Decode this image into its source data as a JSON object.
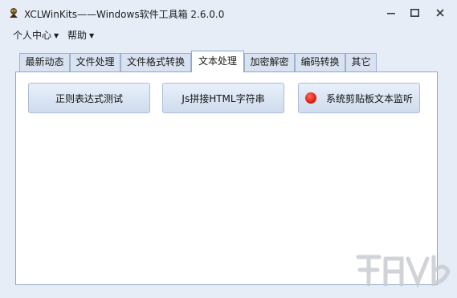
{
  "window": {
    "title": "XCLWinKits——Windows软件工具箱 2.6.0.0",
    "controls": {
      "minimize": "minimize-icon",
      "maximize": "maximize-icon",
      "close": "close-icon"
    }
  },
  "menu": {
    "items": [
      {
        "label": "个人中心"
      },
      {
        "label": "帮助"
      }
    ]
  },
  "tabs": [
    {
      "label": "最新动态"
    },
    {
      "label": "文件处理"
    },
    {
      "label": "文件格式转换"
    },
    {
      "label": "文本处理",
      "active": true
    },
    {
      "label": "加密解密"
    },
    {
      "label": "编码转换"
    },
    {
      "label": "其它"
    }
  ],
  "panel": {
    "buttons": [
      {
        "label": "正则表达式测试"
      },
      {
        "label": "Js拼接HTML字符串"
      },
      {
        "label": "系统剪贴板文本监听",
        "indicator_color": "#e02010"
      }
    ]
  },
  "watermark": {
    "logo": "xiazaiba-watermark"
  },
  "colors": {
    "background": "#e6edf7",
    "tab_border": "#8fa7c9",
    "button_top": "#e8f0fb",
    "button_bottom": "#cfdced"
  }
}
